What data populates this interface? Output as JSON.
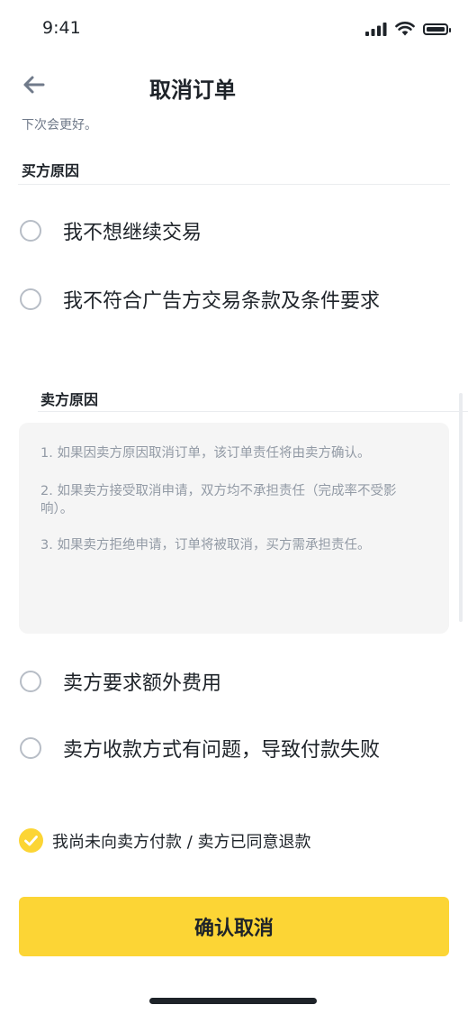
{
  "status_bar": {
    "time": "9:41"
  },
  "header": {
    "title": "取消订单"
  },
  "hint": "下次会更好。",
  "buyer_section": {
    "title": "买方原因",
    "options": [
      {
        "label": "我不想继续交易"
      },
      {
        "label": "我不符合广告方交易条款及条件要求"
      }
    ]
  },
  "seller_section": {
    "title": "卖方原因",
    "info_lines": [
      "1. 如果因卖方原因取消订单，该订单责任将由卖方确认。",
      "2. 如果卖方接受取消申请，双方均不承担责任（完成率不受影响）。",
      "3. 如果卖方拒绝申请，订单将被取消，买方需承担责任。"
    ],
    "options": [
      {
        "label": "卖方要求额外费用"
      },
      {
        "label": "卖方收款方式有问题，导致付款失败"
      }
    ]
  },
  "agreement": {
    "label": "我尚未向卖方付款 / 卖方已同意退款",
    "checked": true
  },
  "confirm_button": {
    "label": "确认取消"
  },
  "colors": {
    "accent": "#fcd535",
    "text_primary": "#1e2329",
    "text_secondary": "#707a8a",
    "radio_border": "#b7bdc6",
    "info_bg": "#f5f5f5"
  }
}
